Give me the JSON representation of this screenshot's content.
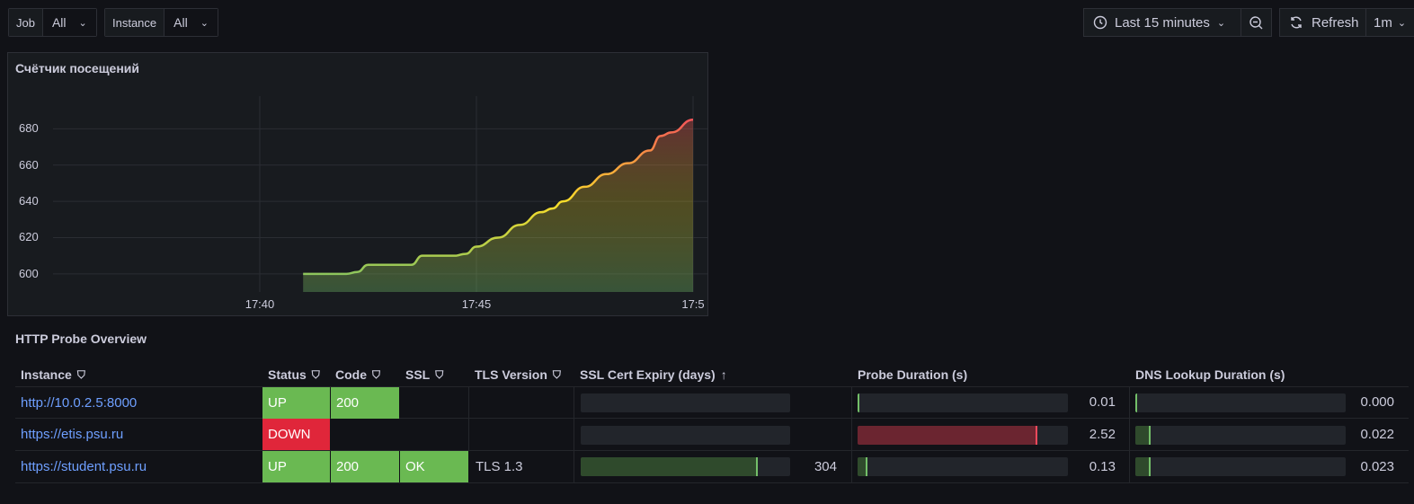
{
  "variables": [
    {
      "label": "Job",
      "value": "All"
    },
    {
      "label": "Instance",
      "value": "All"
    }
  ],
  "toolbar": {
    "time_range": "Last 15 minutes",
    "refresh_label": "Refresh",
    "refresh_interval": "1m"
  },
  "panel": {
    "title": "Счётчик посещений"
  },
  "chart_data": {
    "type": "area",
    "x": [
      "17:41:00",
      "17:41:30",
      "17:42:00",
      "17:42:15",
      "17:42:30",
      "17:42:45",
      "17:43:00",
      "17:43:30",
      "17:43:45",
      "17:44:00",
      "17:44:30",
      "17:44:45",
      "17:45:00",
      "17:45:30",
      "17:46:00",
      "17:46:30",
      "17:46:45",
      "17:47:00",
      "17:47:30",
      "17:48:00",
      "17:48:30",
      "17:49:00",
      "17:49:15",
      "17:49:30",
      "17:50:00"
    ],
    "values": [
      600,
      600,
      600,
      601,
      605,
      605,
      605,
      605,
      610,
      610,
      610,
      611,
      615,
      620,
      627,
      634,
      636,
      640,
      648,
      655,
      661,
      668,
      676,
      678,
      685
    ],
    "xticks": [
      "17:40",
      "17:45",
      "17:5"
    ],
    "yticks": [
      600,
      620,
      640,
      660,
      680
    ],
    "ylim": [
      590,
      698
    ],
    "colors": {
      "low": "#73bf69",
      "mid": "#fade2a",
      "high": "#f2495c"
    }
  },
  "table": {
    "title": "HTTP Probe Overview",
    "headers": {
      "instance": "Instance",
      "status": "Status",
      "code": "Code",
      "ssl": "SSL",
      "tls": "TLS Version",
      "expiry": "SSL Cert Expiry (days)",
      "probe": "Probe Duration (s)",
      "dns": "DNS Lookup Duration (s)"
    },
    "rows": [
      {
        "instance": "http://10.0.2.5:8000",
        "status": "UP",
        "status_color": "#6ab952",
        "code": "200",
        "ssl": "",
        "tls": "",
        "expiry": "",
        "expiry_fraction": 0,
        "probe": "0.01",
        "probe_fraction": 0.004,
        "probe_color": "green",
        "dns": "0.000",
        "dns_fraction": 0.0
      },
      {
        "instance": "https://etis.psu.ru",
        "status": "DOWN",
        "status_color": "#e0263a",
        "code": "",
        "ssl": "",
        "tls": "",
        "expiry": "",
        "expiry_fraction": 0,
        "probe": "2.52",
        "probe_fraction": 0.85,
        "probe_color": "red",
        "dns": "0.022",
        "dns_fraction": 0.06
      },
      {
        "instance": "https://student.psu.ru",
        "status": "UP",
        "status_color": "#6ab952",
        "code": "200",
        "ssl": "OK",
        "tls": "TLS 1.3",
        "expiry": "304",
        "expiry_fraction": 0.84,
        "probe": "0.13",
        "probe_fraction": 0.04,
        "probe_color": "green",
        "dns": "0.023",
        "dns_fraction": 0.06
      }
    ]
  }
}
